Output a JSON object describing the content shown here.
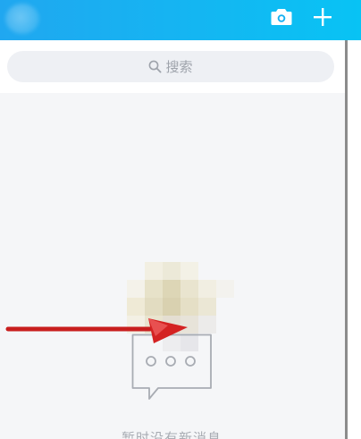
{
  "header": {
    "camera_icon": "camera-icon",
    "add_icon": "plus-icon",
    "color_start": "#20a7f0",
    "color_end": "#08c3f4"
  },
  "search": {
    "placeholder": "搜索",
    "icon": "search-icon"
  },
  "empty_state": {
    "icon": "chat-bubble-icon",
    "message": "暂时没有新消息"
  }
}
